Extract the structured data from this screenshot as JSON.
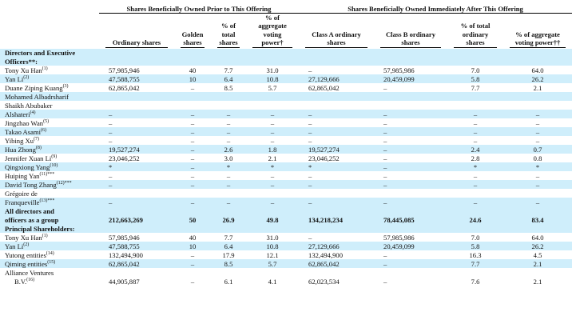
{
  "header": {
    "group_prior": "Shares Beneficially Owned Prior to This Offering",
    "group_after": "Shares Beneficially Owned Immediately After This Offering",
    "columns": [
      "Ordinary shares",
      "Golden shares",
      "% of total shares",
      "% of aggregate voting power†",
      "Class A ordinary shares",
      "Class B ordinary shares",
      "% of total ordinary shares",
      "% of aggregate voting power††"
    ]
  },
  "sections": {
    "directors": "Directors and Executive Officers**:",
    "principal": "Principal Shareholders:"
  },
  "rows_directors": [
    {
      "name": "Tony Xu Han",
      "fn": "(1)",
      "v": [
        "57,985,946",
        "40",
        "7.7",
        "31.0",
        "–",
        "57,985,986",
        "7.0",
        "64.0"
      ]
    },
    {
      "name": "Yan Li",
      "fn": "(2)",
      "v": [
        "47,588,755",
        "10",
        "6.4",
        "10.8",
        "27,129,666",
        "20,459,099",
        "5.8",
        "26.2"
      ]
    },
    {
      "name": "Duane Ziping Kuang",
      "fn": "(3)",
      "v": [
        "62,865,042",
        "–",
        "8.5",
        "5.7",
        "62,865,042",
        "–",
        "7.7",
        "2.1"
      ]
    },
    {
      "name": "Mohamed Albadrsharif",
      "fn": "",
      "v": [
        "",
        "",
        "",
        "",
        "",
        "",
        "",
        ""
      ]
    },
    {
      "name": "Shaikh Abubaker",
      "fn": "",
      "v": [
        "",
        "",
        "",
        "",
        "",
        "",
        "",
        ""
      ]
    },
    {
      "name": "Alshateri",
      "fn": "(4)",
      "v": [
        "–",
        "–",
        "–",
        "–",
        "–",
        "–",
        "–",
        "–"
      ]
    },
    {
      "name": "Jingzhao Wan",
      "fn": "(5)",
      "v": [
        "–",
        "–",
        "–",
        "–",
        "–",
        "–",
        "–",
        "–"
      ]
    },
    {
      "name": "Takao Asami",
      "fn": "(6)",
      "v": [
        "–",
        "–",
        "–",
        "–",
        "–",
        "–",
        "–",
        "–"
      ]
    },
    {
      "name": "Yibing Xu",
      "fn": "(7)",
      "v": [
        "–",
        "–",
        "–",
        "–",
        "–",
        "–",
        "–",
        "–"
      ]
    },
    {
      "name": "Hua Zhong",
      "fn": "(8)",
      "v": [
        "19,527,274",
        "–",
        "2.6",
        "1.8",
        "19,527,274",
        "–",
        "2.4",
        "0.7"
      ]
    },
    {
      "name": "Jennifer Xuan Li",
      "fn": "(9)",
      "v": [
        "23,046,252",
        "–",
        "3.0",
        "2.1",
        "23,046,252",
        "–",
        "2.8",
        "0.8"
      ]
    },
    {
      "name": "Qingxiong Yang",
      "fn": "(10)",
      "v": [
        "*",
        "–",
        "*",
        "*",
        "*",
        "–",
        "*",
        "*"
      ]
    },
    {
      "name": "Huiping Yan",
      "fn": "(11)***",
      "v": [
        "–",
        "–",
        "–",
        "–",
        "–",
        "–",
        "–",
        "–"
      ]
    },
    {
      "name": "David Tong Zhang",
      "fn": "(12)***",
      "v": [
        "–",
        "–",
        "–",
        "–",
        "–",
        "–",
        "–",
        "–"
      ]
    },
    {
      "name": "Grégoire de",
      "fn": "",
      "v": [
        "",
        "",
        "",
        "",
        "",
        "",
        "",
        ""
      ]
    },
    {
      "name": "Franqueville",
      "fn": "(13)***",
      "v": [
        "–",
        "–",
        "–",
        "–",
        "–",
        "–",
        "–",
        "–"
      ]
    }
  ],
  "total_row": {
    "line1": "All directors and",
    "line2": "officers as a group",
    "v": [
      "212,663,269",
      "50",
      "26.9",
      "49.8",
      "134,218,234",
      "78,445,085",
      "24.6",
      "83.4"
    ]
  },
  "rows_principal": [
    {
      "name": "Tony Xu Han",
      "fn": "(1)",
      "v": [
        "57,985,946",
        "40",
        "7.7",
        "31.0",
        "–",
        "57,985,986",
        "7.0",
        "64.0"
      ]
    },
    {
      "name": "Yan Li",
      "fn": "(2)",
      "v": [
        "47,588,755",
        "10",
        "6.4",
        "10.8",
        "27,129,666",
        "20,459,099",
        "5.8",
        "26.2"
      ]
    },
    {
      "name": "Yutong entities",
      "fn": "(14)",
      "v": [
        "132,494,900",
        "–",
        "17.9",
        "12.1",
        "132,494,900",
        "–",
        "16.3",
        "4.5"
      ]
    },
    {
      "name": "Qiming entities",
      "fn": "(15)",
      "v": [
        "62,865,042",
        "–",
        "8.5",
        "5.7",
        "62,865,042",
        "–",
        "7.7",
        "2.1"
      ]
    }
  ],
  "last_row": {
    "line1": "Alliance Ventures",
    "line2": "B.V.",
    "fn": "(16)",
    "v": [
      "44,905,887",
      "–",
      "6.1",
      "4.1",
      "62,023,534",
      "–",
      "7.6",
      "2.1"
    ]
  }
}
